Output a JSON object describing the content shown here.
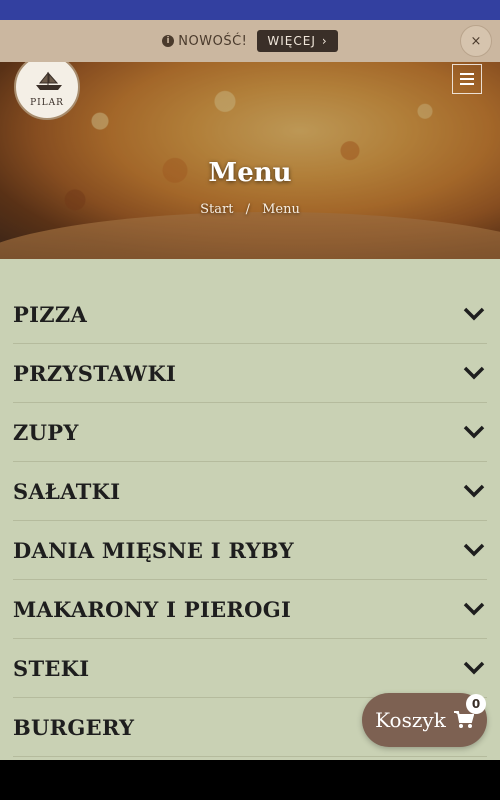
{
  "notice": {
    "label": "NOWOŚĆ!",
    "more_label": "WIĘCEJ",
    "more_chevron": "›",
    "close": "×"
  },
  "hero": {
    "logo_text": "PILAR",
    "title": "Menu",
    "breadcrumb": {
      "home": "Start",
      "separator": "/",
      "current": "Menu"
    }
  },
  "categories": [
    "PIZZA",
    "PRZYSTAWKI",
    "ZUPY",
    "SAŁATKI",
    "DANIA MIĘSNE I RYBY",
    "MAKARONY I PIEROGI",
    "STEKI",
    "BURGERY"
  ],
  "cart": {
    "label": "Koszyk",
    "count": "0",
    "icon": "cart-icon"
  },
  "colors": {
    "topbar": "#3340a0",
    "notice_bg": "#cbb7a0",
    "list_bg": "#c9d1b4",
    "cart_bg": "#7d6152"
  }
}
